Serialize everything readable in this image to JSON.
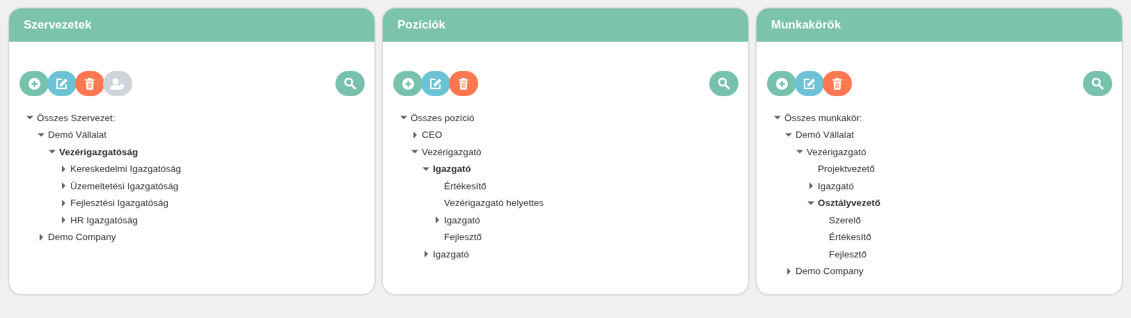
{
  "panels": [
    {
      "title": "Szervezetek",
      "buttons": [
        {
          "kind": "add",
          "disabled": false
        },
        {
          "kind": "edit",
          "disabled": false
        },
        {
          "kind": "delete",
          "disabled": false
        },
        {
          "kind": "assign",
          "disabled": true
        }
      ],
      "tree": [
        {
          "label": "Összes Szervezet:",
          "kind": "branch",
          "expanded": true,
          "selected": false,
          "children": [
            {
              "label": "Demó Vállalat",
              "kind": "branch",
              "expanded": true,
              "selected": false,
              "children": [
                {
                  "label": "Vezérigazgatóság",
                  "kind": "branch",
                  "expanded": true,
                  "selected": true,
                  "children": [
                    {
                      "label": "Kereskedelmi Igazgatóság",
                      "kind": "branch",
                      "expanded": false,
                      "selected": false
                    },
                    {
                      "label": "Üzemeltetési Igazgatóság",
                      "kind": "branch",
                      "expanded": false,
                      "selected": false
                    },
                    {
                      "label": "Fejlesztési Igazgatóság",
                      "kind": "branch",
                      "expanded": false,
                      "selected": false
                    },
                    {
                      "label": "HR Igazgatóság",
                      "kind": "branch",
                      "expanded": false,
                      "selected": false
                    }
                  ]
                }
              ]
            },
            {
              "label": "Demo Company",
              "kind": "branch",
              "expanded": false,
              "selected": false
            }
          ]
        }
      ]
    },
    {
      "title": "Pozíciók",
      "buttons": [
        {
          "kind": "add",
          "disabled": false
        },
        {
          "kind": "edit",
          "disabled": false
        },
        {
          "kind": "delete",
          "disabled": false
        }
      ],
      "tree": [
        {
          "label": "Összes pozíció",
          "kind": "branch",
          "expanded": true,
          "selected": false,
          "children": [
            {
              "label": "CEO",
              "kind": "branch",
              "expanded": false,
              "selected": false
            },
            {
              "label": "Vezérigazgató",
              "kind": "branch",
              "expanded": true,
              "selected": false,
              "children": [
                {
                  "label": "Igazgató",
                  "kind": "branch",
                  "expanded": true,
                  "selected": true,
                  "children": [
                    {
                      "label": "Értékesítő",
                      "kind": "leaf",
                      "selected": false
                    },
                    {
                      "label": "Vezérigazgató helyettes",
                      "kind": "leaf",
                      "selected": false
                    },
                    {
                      "label": "Igazgató",
                      "kind": "branch",
                      "expanded": false,
                      "selected": false
                    },
                    {
                      "label": "Fejlesztő",
                      "kind": "leaf",
                      "selected": false
                    }
                  ]
                },
                {
                  "label": "Igazgató",
                  "kind": "branch",
                  "expanded": false,
                  "selected": false
                }
              ]
            }
          ]
        }
      ]
    },
    {
      "title": "Munkakörök",
      "buttons": [
        {
          "kind": "add",
          "disabled": false
        },
        {
          "kind": "edit",
          "disabled": false
        },
        {
          "kind": "delete",
          "disabled": false
        }
      ],
      "tree": [
        {
          "label": "Összes munkakör:",
          "kind": "branch",
          "expanded": true,
          "selected": false,
          "children": [
            {
              "label": "Demó Vállalat",
              "kind": "branch",
              "expanded": true,
              "selected": false,
              "children": [
                {
                  "label": "Vezérigazgató",
                  "kind": "branch",
                  "expanded": true,
                  "selected": false,
                  "children": [
                    {
                      "label": "Projektvezető",
                      "kind": "leaf",
                      "selected": false
                    },
                    {
                      "label": "Igazgató",
                      "kind": "branch",
                      "expanded": false,
                      "selected": false
                    },
                    {
                      "label": "Osztályvezető",
                      "kind": "branch",
                      "expanded": true,
                      "selected": true,
                      "children": [
                        {
                          "label": "Szerelő",
                          "kind": "leaf",
                          "selected": false
                        },
                        {
                          "label": "Értékesítő",
                          "kind": "leaf",
                          "selected": false
                        },
                        {
                          "label": "Fejlesztő",
                          "kind": "leaf",
                          "selected": false
                        }
                      ]
                    }
                  ]
                }
              ]
            },
            {
              "label": "Demo Company",
              "kind": "branch",
              "expanded": false,
              "selected": false
            }
          ]
        }
      ]
    }
  ]
}
